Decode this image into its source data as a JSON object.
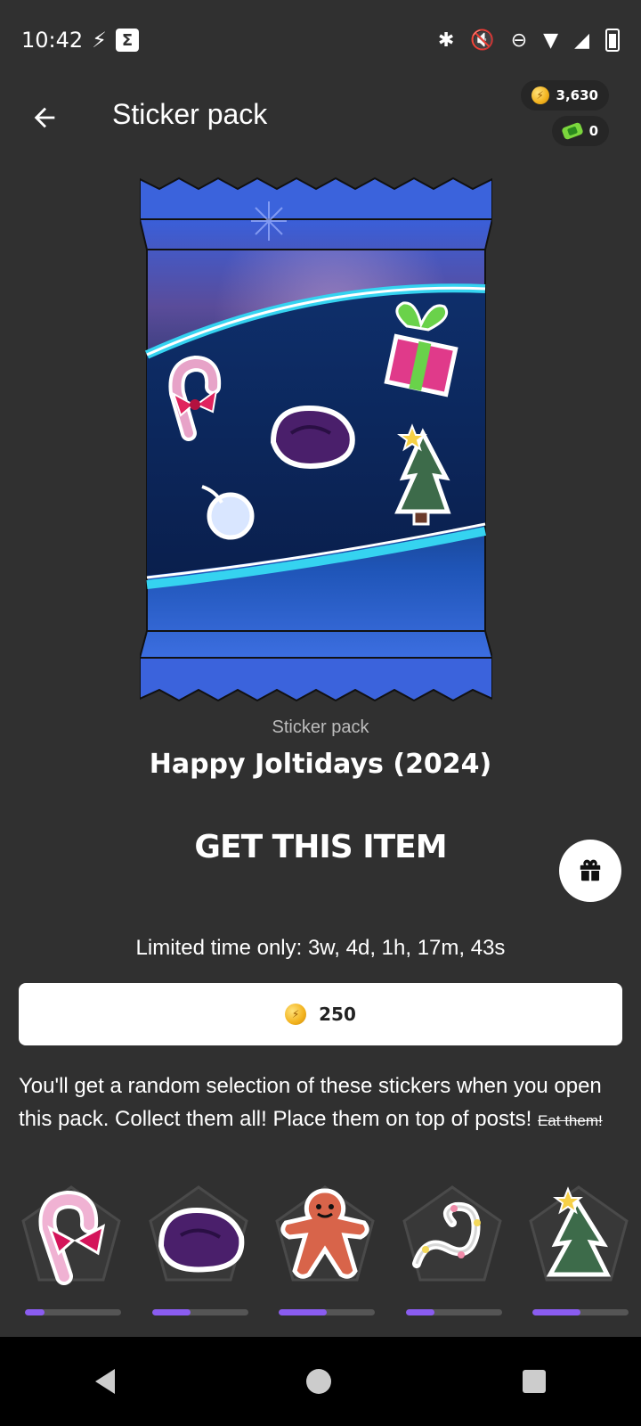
{
  "status_bar": {
    "time": "10:42",
    "icons": [
      "bolt-icon",
      "sigma-icon",
      "bluetooth-icon",
      "mute-icon",
      "dnd-icon",
      "wifi-icon",
      "signal-icon",
      "battery-icon"
    ]
  },
  "header": {
    "title": "Sticker pack",
    "coins": "3,630",
    "gems": "0"
  },
  "pack": {
    "subtitle": "Sticker pack",
    "name": "Happy Joltidays (2024)"
  },
  "purchase": {
    "heading": "GET THIS ITEM",
    "limited": "Limited time only: 3w, 4d, 1h, 17m, 43s",
    "price": "250"
  },
  "description": {
    "text": "You'll get a random selection of these stickers when you open this pack. Collect them all! Place them on top of posts!",
    "struck": "Eat them!"
  },
  "stickers": [
    {
      "name": "candy-cane-sticker",
      "progress": 0.2
    },
    {
      "name": "coal-sticker",
      "progress": 0.4
    },
    {
      "name": "gingerbread-sticker",
      "progress": 0.5
    },
    {
      "name": "lights-sticker",
      "progress": 0.3
    },
    {
      "name": "tree-sticker",
      "progress": 0.5
    }
  ]
}
